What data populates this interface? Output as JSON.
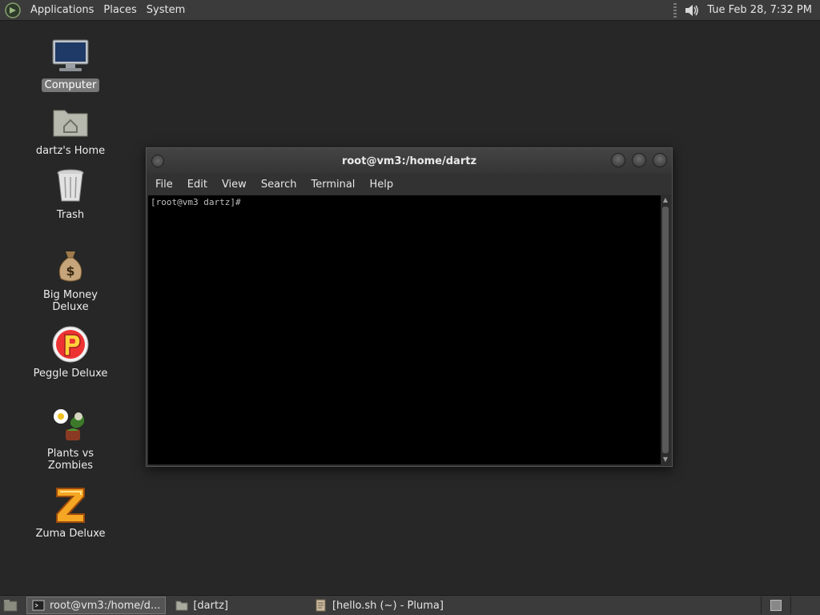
{
  "top_panel": {
    "menus": [
      "Applications",
      "Places",
      "System"
    ],
    "clock": "Tue Feb 28,  7:32 PM",
    "distro_icon": "mate-logo-icon",
    "volume_icon": "speaker-icon"
  },
  "desktop_icons": [
    {
      "label": "Computer",
      "icon": "computer-icon",
      "selected": true
    },
    {
      "label": "dartz's Home",
      "icon": "home-folder-icon"
    },
    {
      "label": "Trash",
      "icon": "trash-icon"
    },
    {
      "label": "Big Money Deluxe",
      "icon": "money-bag-icon"
    },
    {
      "label": "Peggle Deluxe",
      "icon": "peggle-icon"
    },
    {
      "label": "Plants vs Zombies",
      "icon": "plants-vs-zombies-icon"
    },
    {
      "label": "Zuma Deluxe",
      "icon": "zuma-icon"
    }
  ],
  "terminal": {
    "title": "root@vm3:/home/dartz",
    "menus": [
      "File",
      "Edit",
      "View",
      "Search",
      "Terminal",
      "Help"
    ],
    "prompt": "[root@vm3 dartz]#"
  },
  "taskbar": {
    "tasks": [
      {
        "label": "root@vm3:/home/d...",
        "icon": "terminal-icon",
        "active": true
      },
      {
        "label": "[dartz]",
        "icon": "folder-icon",
        "active": false
      },
      {
        "label": "[hello.sh (~) - Pluma]",
        "icon": "text-editor-icon",
        "active": false
      }
    ]
  },
  "colors": {
    "desktop_bg": "#262726",
    "panel_bg": "#3a3b3a",
    "terminal_bg": "#000000"
  }
}
